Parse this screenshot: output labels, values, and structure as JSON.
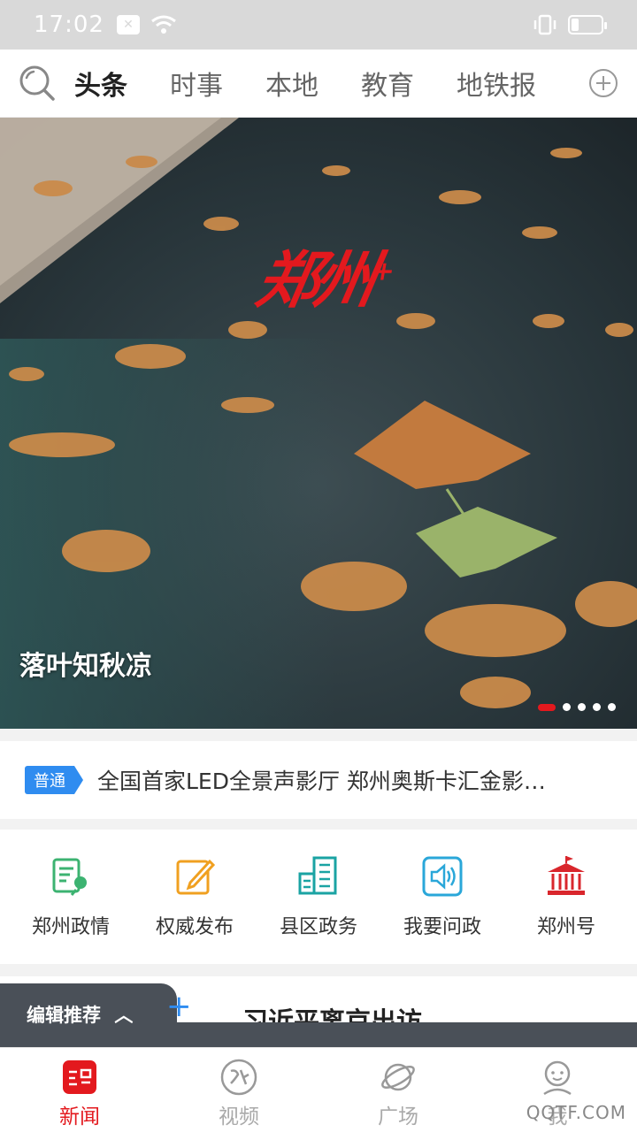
{
  "status_bar": {
    "time": "17:02"
  },
  "top_nav": {
    "tabs": [
      "头条",
      "时事",
      "本地",
      "教育",
      "地铁报"
    ]
  },
  "hero": {
    "caption": "落叶知秋凉",
    "logo_text": "郑州",
    "logo_plus": "+",
    "slide_count": 5,
    "active_slide": 1
  },
  "ticker": {
    "tag": "普通",
    "text": "全国首家LED全景声影厅 郑州奥斯卡汇金影…"
  },
  "quick_links": [
    {
      "label": "郑州政情",
      "icon": "microphone-doc-icon"
    },
    {
      "label": "权威发布",
      "icon": "edit-icon"
    },
    {
      "label": "县区政务",
      "icon": "building-icon"
    },
    {
      "label": "我要问政",
      "icon": "speaker-icon"
    },
    {
      "label": "郑州号",
      "icon": "hall-icon"
    }
  ],
  "editor": {
    "tab_label": "编辑推荐",
    "headline": "习近平离京出访"
  },
  "bottom_nav": [
    {
      "label": "新闻",
      "icon": "news-icon",
      "active": true
    },
    {
      "label": "视频",
      "icon": "video-icon",
      "active": false
    },
    {
      "label": "广场",
      "icon": "planet-icon",
      "active": false
    },
    {
      "label": "我",
      "icon": "user-icon",
      "active": false
    }
  ],
  "watermark": "QQTF.COM",
  "colors": {
    "accent": "#e3191e",
    "blue": "#2f8cf0",
    "dark_tab": "#4a5058"
  }
}
